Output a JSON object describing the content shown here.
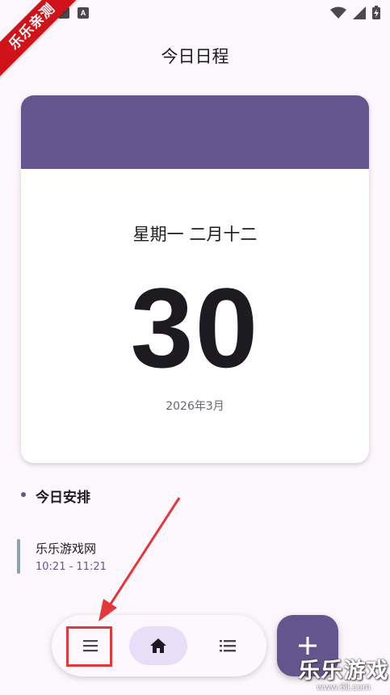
{
  "ribbon": {
    "text": "乐乐亲测"
  },
  "status_bar": {
    "icons": [
      "notification-icon",
      "a-icon",
      "wifi-icon",
      "signal-icon",
      "battery-icon"
    ],
    "a_label": "A"
  },
  "header": {
    "title": "今日日程"
  },
  "date_card": {
    "weekday_lunar": "星期一 二月十二",
    "day": "30",
    "year_month": "2026年3月",
    "header_color": "#65558f"
  },
  "schedule": {
    "title": "今日安排",
    "events": [
      {
        "title": "乐乐游戏网",
        "time": "10:21 - 11:21"
      }
    ]
  },
  "bottom_nav": {
    "items": [
      {
        "icon": "menu-icon",
        "selected": false
      },
      {
        "icon": "home-icon",
        "selected": true
      },
      {
        "icon": "list-icon",
        "selected": false
      }
    ]
  },
  "fab": {
    "icon": "add-icon"
  },
  "watermark": {
    "main": "乐乐游戏",
    "sub": "www.6ll.com"
  },
  "colors": {
    "accent": "#65558f",
    "highlight": "#e2383a",
    "nav_selected": "#e8def8"
  }
}
